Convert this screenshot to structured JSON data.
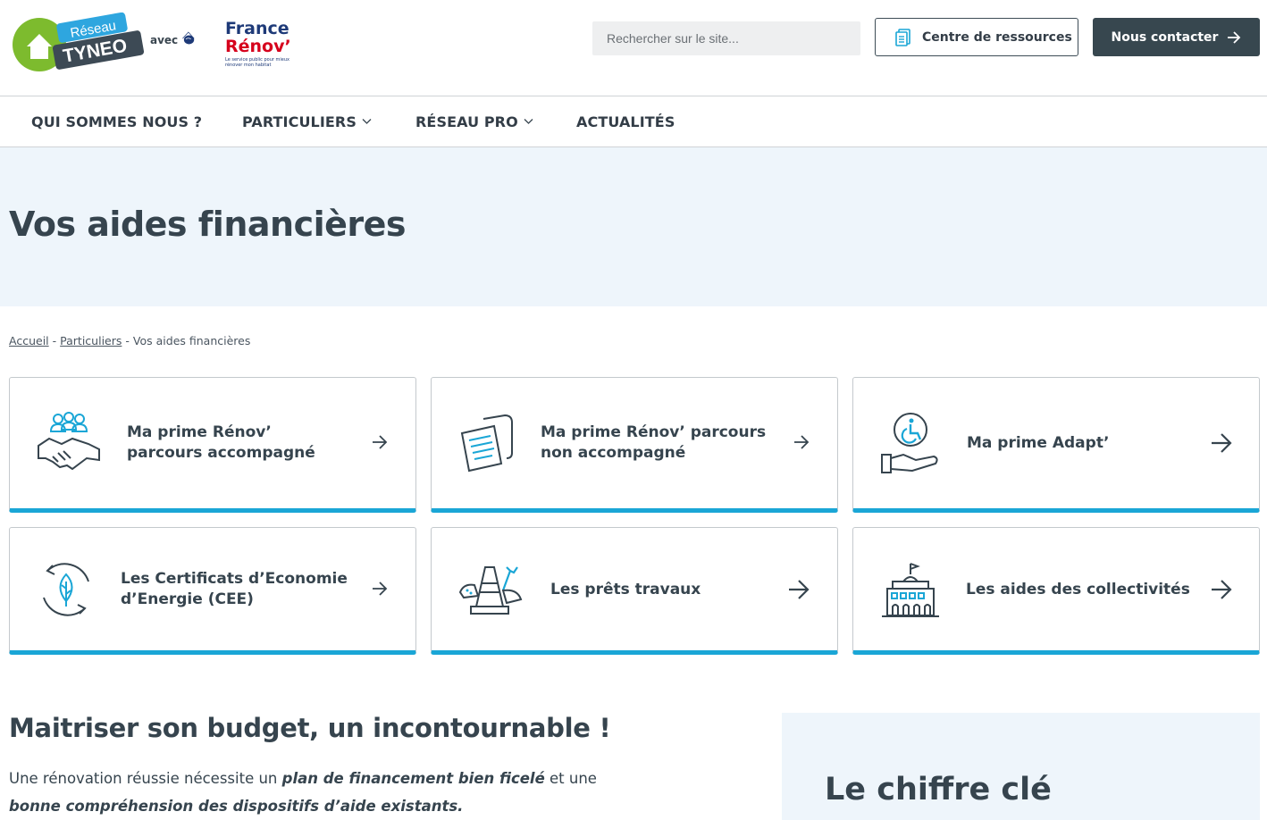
{
  "header": {
    "logo_tyneo_top": "Réseau",
    "logo_tyneo_main": "TYNEO",
    "logo_avec": "avec",
    "logo_fr_line1": "France",
    "logo_fr_line2": "Rénov’",
    "logo_fr_small": "Le service public pour mieux rénover mon habitat",
    "search_placeholder": "Rechercher sur le site...",
    "resources_label": "Centre de ressources",
    "contact_label": "Nous contacter"
  },
  "nav": {
    "items": [
      {
        "label": "QUI SOMMES NOUS ?"
      },
      {
        "label": "PARTICULIERS"
      },
      {
        "label": "RÉSEAU PRO"
      },
      {
        "label": "ACTUALITÉS"
      }
    ]
  },
  "hero": {
    "title": "Vos aides financières"
  },
  "breadcrumb": {
    "home": "Accueil",
    "sep1": "-",
    "parent": "Particuliers",
    "sep2": "-",
    "current": "Vos aides financières"
  },
  "cards": [
    {
      "label": "Ma prime Rénov’ parcours accompagné",
      "icon": "handshake-icon"
    },
    {
      "label": "Ma prime Rénov’ parcours non accompagné",
      "icon": "document-scroll-icon"
    },
    {
      "label": "Ma prime Adapt’",
      "icon": "accessibility-hand-icon"
    },
    {
      "label": "Les Certificats d’Economie d’Energie (CEE)",
      "icon": "eco-leaf-icon"
    },
    {
      "label": "Les prêts travaux",
      "icon": "construction-cone-icon"
    },
    {
      "label": "Les aides des collectivités",
      "icon": "town-hall-icon"
    }
  ],
  "section": {
    "title": "Maitriser son budget, un incontournable !",
    "p_part1": "Une rénovation réussie nécessite un",
    "p_bold1": "plan de financement bien ficelé",
    "p_part2": "et une",
    "p_bold2": "bonne compréhension des dispositifs d’aide existants."
  },
  "key_figure": {
    "title": "Le chiffre clé"
  },
  "colors": {
    "accent": "#1aa6d6",
    "dark": "#37474f",
    "hero_bg": "#eef5fb"
  }
}
